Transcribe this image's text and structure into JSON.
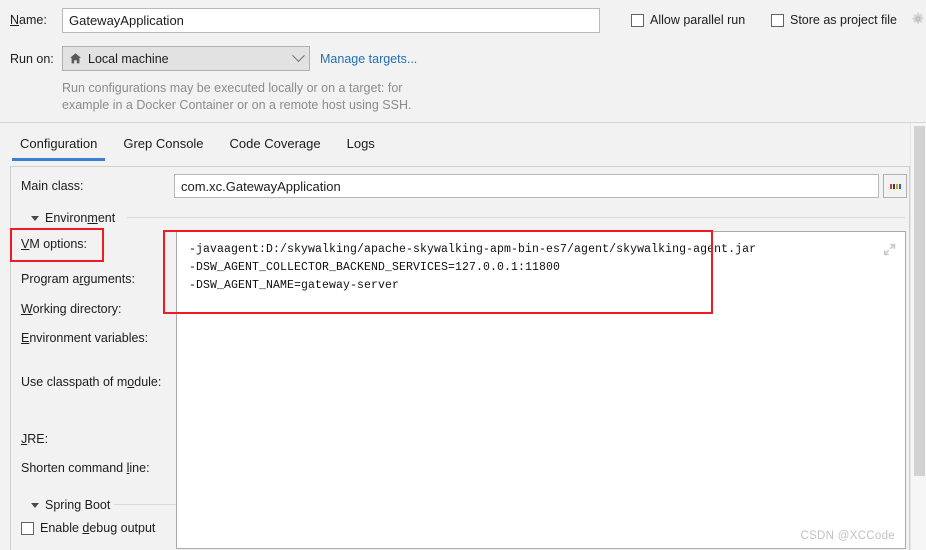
{
  "top": {
    "name_label": "Name:",
    "name_value": "GatewayApplication",
    "name_placeholder": "Name",
    "allow_parallel_run": "Allow parallel run",
    "store_as_project_file": "Store as project file",
    "gear_icon": "gear-icon",
    "run_on_label": "Run on:",
    "run_on_value": "Local machine",
    "run_on_icon": "home-icon",
    "manage_targets": "Manage targets...",
    "hint_line1": "Run configurations may be executed locally or on a target: for",
    "hint_line2": "example in a Docker Container or on a remote host using SSH."
  },
  "tabs": [
    {
      "label": "Configuration",
      "active": true
    },
    {
      "label": "Grep Console",
      "active": false
    },
    {
      "label": "Code Coverage",
      "active": false
    },
    {
      "label": "Logs",
      "active": false
    }
  ],
  "config": {
    "main_class_label": "Main class:",
    "main_class_value": "com.xc.GatewayApplication",
    "main_class_placeholder": "Main class",
    "browse_button": "...",
    "environment_section": "Environment",
    "spring_boot_section": "Spring Boot",
    "fields": {
      "vm_options": "VM options:",
      "program_arguments": "Program arguments:",
      "working_directory": "Working directory:",
      "environment_variables": "Environment variables:",
      "use_classpath_of_module": "Use classpath of module:",
      "jre": "JRE:",
      "shorten_command_line": "Shorten command line:"
    },
    "enable_debug_output": "Enable debug output",
    "vm_options_value": "-javaagent:D:/skywalking/apache-skywalking-apm-bin-es7/agent/skywalking-agent.jar\n-DSW_AGENT_COLLECTOR_BACKEND_SERVICES=127.0.0.1:11800\n-DSW_AGENT_NAME=gateway-server",
    "expand_icon": "expand-icon"
  },
  "watermark": "CSDN @XCCode",
  "colors": {
    "accent_blue": "#3c7dd0",
    "link_blue": "#2470b3",
    "annotation_red": "#ee1b24",
    "panel_bg": "#f2f2f2",
    "field_bg": "#ffffff",
    "hint_gray": "#8b8b8b"
  }
}
